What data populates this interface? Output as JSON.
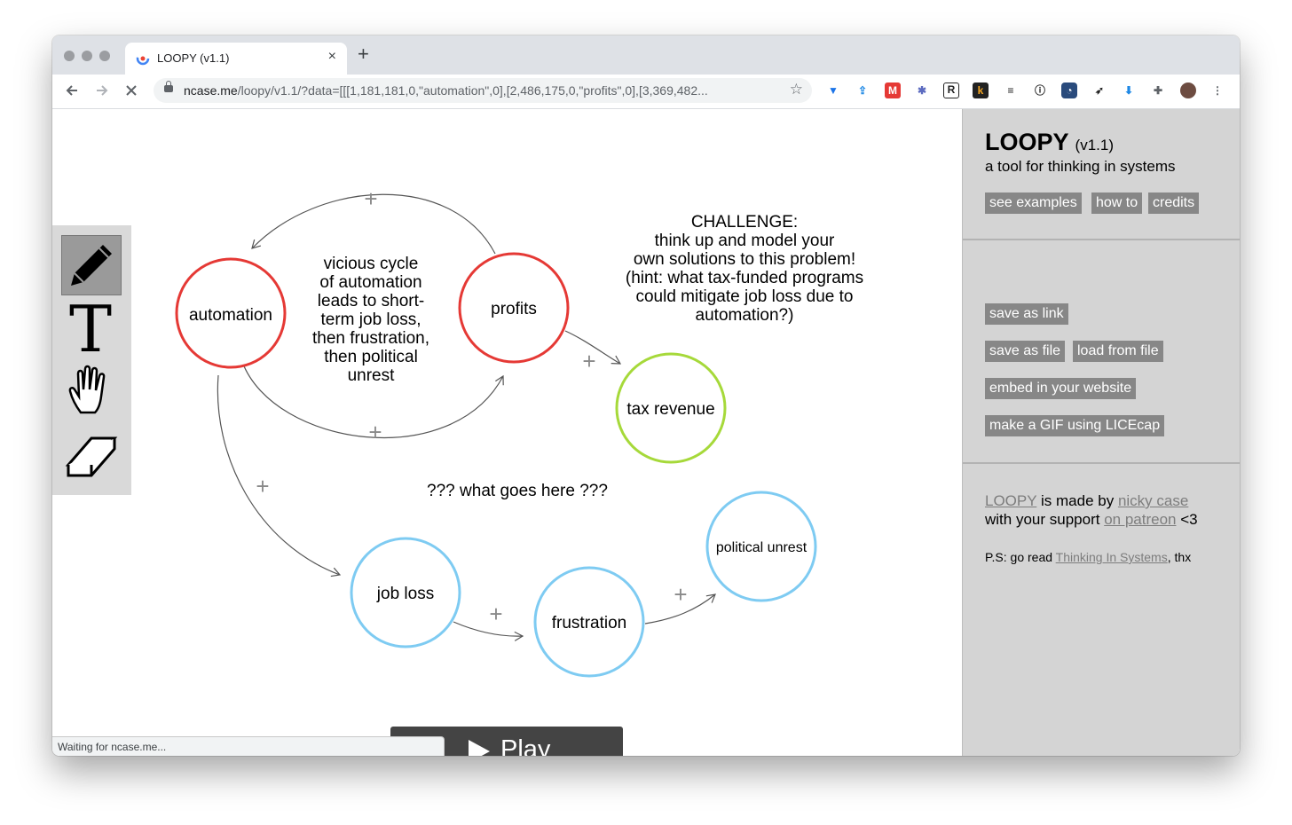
{
  "browser": {
    "tab_title": "LOOPY (v1.1)",
    "tab_close": "×",
    "new_tab": "+",
    "url_host": "ncase.me",
    "url_path": "/loopy/v1.1/?data=[[[1,181,181,0,\"automation\",0],[2,486,175,0,\"profits\",0],[3,369,482...",
    "status_text": "Waiting for ncase.me..."
  },
  "diagram": {
    "nodes": [
      {
        "id": "automation",
        "label": "automation",
        "color": "#e53935"
      },
      {
        "id": "profits",
        "label": "profits",
        "color": "#e53935"
      },
      {
        "id": "tax_revenue",
        "label": "tax revenue",
        "color": "#a6d93a"
      },
      {
        "id": "job_loss",
        "label": "job loss",
        "color": "#7ecbf2"
      },
      {
        "id": "frustration",
        "label": "frustration",
        "color": "#7ecbf2"
      },
      {
        "id": "political_unrest",
        "label": "political unrest",
        "color": "#7ecbf2"
      }
    ],
    "edges": [
      {
        "from": "profits",
        "to": "automation",
        "sign": "+"
      },
      {
        "from": "automation",
        "to": "profits",
        "sign": "+"
      },
      {
        "from": "profits",
        "to": "tax_revenue",
        "sign": "+"
      },
      {
        "from": "automation",
        "to": "job_loss",
        "sign": "+"
      },
      {
        "from": "job_loss",
        "to": "frustration",
        "sign": "+"
      },
      {
        "from": "frustration",
        "to": "political_unrest",
        "sign": "+"
      }
    ],
    "text_vicious": [
      "vicious cycle",
      "of automation",
      "leads to short-",
      "term job loss,",
      "then frustration,",
      "then political",
      "unrest"
    ],
    "text_challenge": [
      "CHALLENGE:",
      "think up and model your",
      "own solutions to this problem!",
      "(hint: what tax-funded programs",
      "could mitigate job loss due to",
      "automation?)"
    ],
    "text_question": "??? what goes here ???"
  },
  "play": {
    "label": "Play"
  },
  "sidebar": {
    "title": "LOOPY",
    "version": "(v1.1)",
    "subtitle": "a tool for thinking in systems",
    "buttons_top": [
      "see examples",
      "how to",
      "credits"
    ],
    "buttons_save": [
      "save as link",
      "save as file",
      "load from file",
      "embed in your website",
      "make a GIF using LICEcap"
    ],
    "credits_1": {
      "link1": "LOOPY",
      "mid": " is made by ",
      "link2": "nicky case"
    },
    "credits_2": {
      "pre": "with your support ",
      "link": "on patreon",
      "post": " <3"
    },
    "ps": {
      "pre": "P.S: go read ",
      "link": "Thinking In Systems",
      "post": ", thx"
    }
  },
  "colors": {
    "sidebar_bg": "#d4d4d4",
    "button_bg": "#878787",
    "play_bg": "#444444"
  }
}
